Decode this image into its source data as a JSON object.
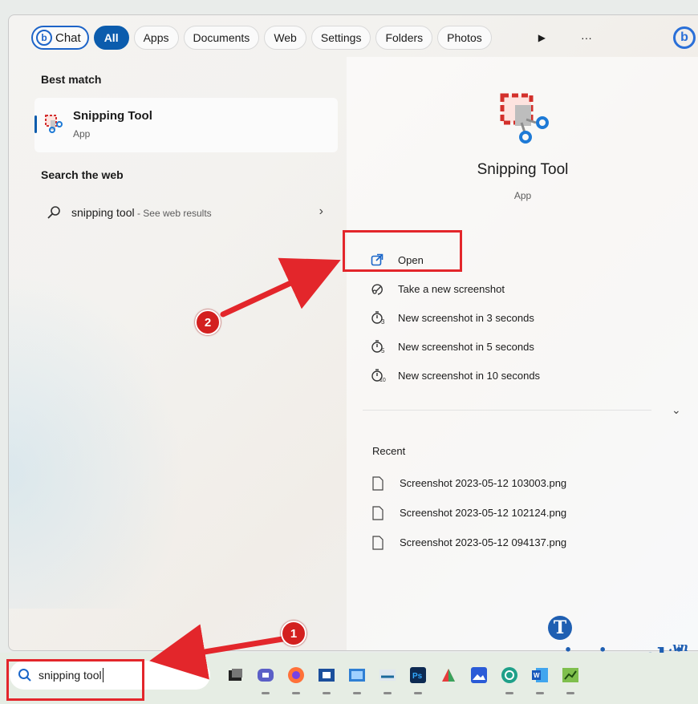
{
  "filters": {
    "chat_label": "Chat",
    "chips": [
      "All",
      "Apps",
      "Documents",
      "Web",
      "Settings",
      "Folders",
      "Photos"
    ],
    "more_label": "···"
  },
  "best_match": {
    "title": "Best match",
    "name": "Snipping Tool",
    "type": "App"
  },
  "search_web": {
    "title": "Search the web",
    "query": "snipping tool",
    "hint": " - See web results"
  },
  "detail": {
    "name": "Snipping Tool",
    "type": "App",
    "actions": [
      {
        "label": "Open",
        "icon": "open-external-icon"
      },
      {
        "label": "Take a new screenshot",
        "icon": "screenshot-icon"
      },
      {
        "label": "New screenshot in 3 seconds",
        "icon": "timer-3-icon",
        "n": "3"
      },
      {
        "label": "New screenshot in 5 seconds",
        "icon": "timer-5-icon",
        "n": "5"
      },
      {
        "label": "New screenshot in 10 seconds",
        "icon": "timer-10-icon",
        "n": "10"
      }
    ],
    "recent_title": "Recent",
    "recent": [
      "Screenshot 2023-05-12 103003.png",
      "Screenshot 2023-05-12 102124.png",
      "Screenshot 2023-05-12 094137.png"
    ]
  },
  "taskbar": {
    "search_text": "snipping tool",
    "apps": [
      "task-view",
      "teams-chat",
      "firefox",
      "media-player",
      "photos",
      "network",
      "photoshop",
      "paint",
      "photo-viewer",
      "refresh-app",
      "word",
      "charts-app"
    ]
  },
  "annotations": {
    "badge1": "1",
    "badge2": "2"
  },
  "watermark": {
    "main": "aimienphi",
    "sub": ".vn"
  },
  "colors": {
    "accent": "#0b5cad",
    "annotation": "#e3262b",
    "bing": "#1d64c8"
  }
}
